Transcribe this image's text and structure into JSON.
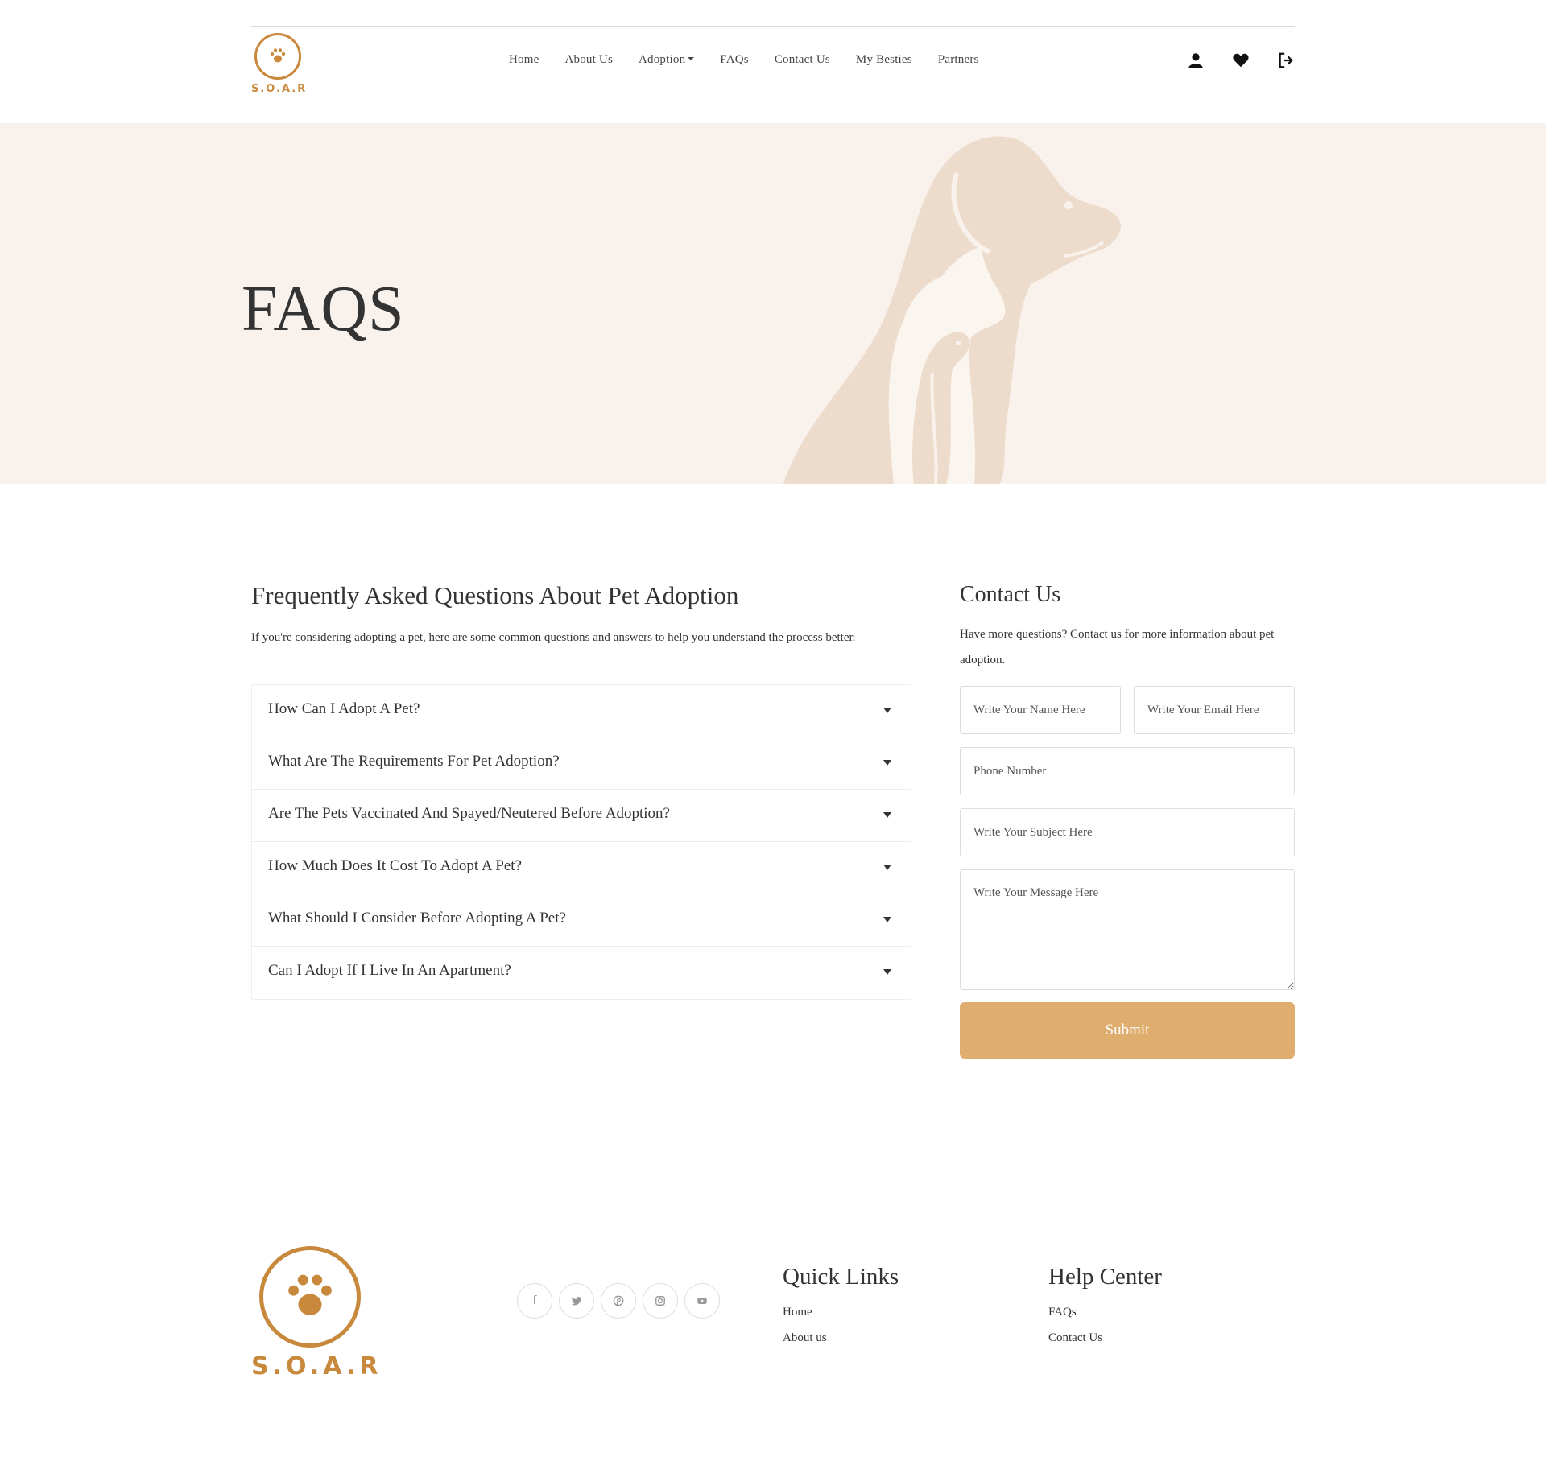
{
  "brand": {
    "name": "S.O.A.R",
    "accent": "#c8893d",
    "button_color": "#dfae6f",
    "hero_bg": "#f9f2ec"
  },
  "nav": {
    "items": [
      {
        "label": "Home"
      },
      {
        "label": "About Us"
      },
      {
        "label": "Adoption",
        "dropdown": true
      },
      {
        "label": "FAQs"
      },
      {
        "label": "Contact Us"
      },
      {
        "label": "My Besties"
      },
      {
        "label": "Partners"
      }
    ],
    "icons": [
      "user-icon",
      "heart-icon",
      "logout-icon"
    ]
  },
  "hero": {
    "title": "FAQS"
  },
  "faq": {
    "title": "Frequently Asked Questions About Pet Adoption",
    "intro": "If you're considering adopting a pet, here are some common questions and answers to help you understand the process better.",
    "questions": [
      "How Can I Adopt A Pet?",
      "What Are The Requirements For Pet Adoption?",
      "Are The Pets Vaccinated And Spayed/Neutered Before Adoption?",
      "How Much Does It Cost To Adopt A Pet?",
      "What Should I Consider Before Adopting A Pet?",
      "Can I Adopt If I Live In An Apartment?"
    ]
  },
  "contact": {
    "title": "Contact Us",
    "intro": "Have more questions? Contact us for more information about pet adoption.",
    "name_placeholder": "Write Your Name Here",
    "email_placeholder": "Write Your Email Here",
    "phone_placeholder": "Phone Number",
    "subject_placeholder": "Write Your Subject Here",
    "message_placeholder": "Write Your Message Here",
    "submit_label": "Submit"
  },
  "footer": {
    "brand": "S.O.A.R",
    "socials": [
      "facebook-icon",
      "twitter-icon",
      "pinterest-icon",
      "instagram-icon",
      "youtube-icon"
    ],
    "quick_links": {
      "title": "Quick Links",
      "links": [
        "Home",
        "About us"
      ]
    },
    "help_center": {
      "title": "Help Center",
      "links": [
        "FAQs",
        "Contact Us"
      ]
    }
  }
}
